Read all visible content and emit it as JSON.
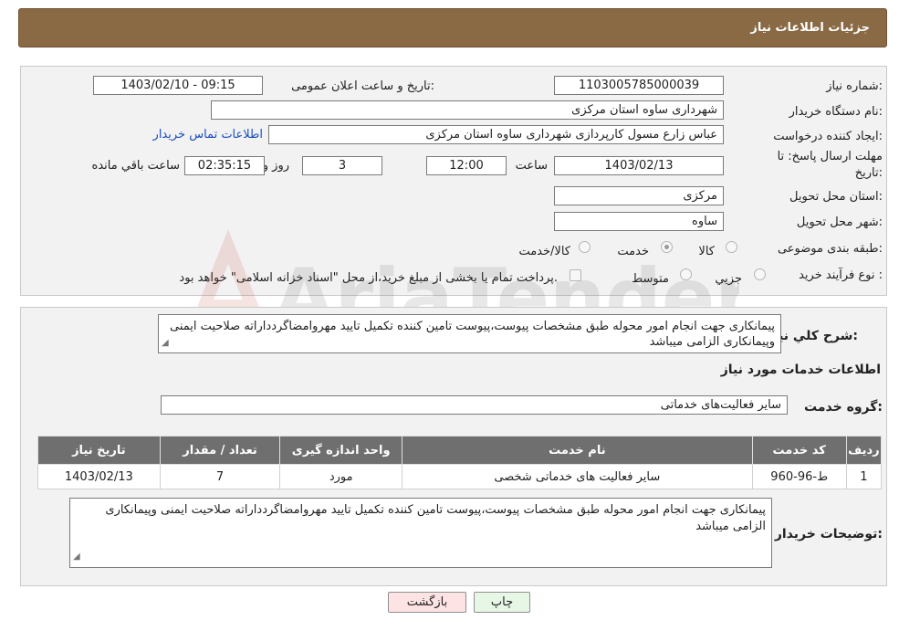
{
  "header": {
    "title": "جزئیات اطلاعات نیاز"
  },
  "need": {
    "number_label": "شماره نیاز:",
    "number_value": "1103005785000039",
    "announce_label": "تاریخ و ساعت اعلان عمومی:",
    "announce_value": "1403/02/10 - 09:15",
    "buyer_label": "نام دستگاه خریدار:",
    "buyer_value": "شهرداری ساوه استان مرکزی",
    "creator_label": "ایجاد کننده درخواست:",
    "creator_value": "عباس زارع مسول کارپردازی شهرداری ساوه استان مرکزی",
    "contact_link": "اطلاعات تماس خریدار",
    "deadline_label_1": "مهلت ارسال پاسخ: تا",
    "deadline_label_2": "تاریخ:",
    "deadline_date": "1403/02/13",
    "time_label": "ساعت",
    "deadline_time": "12:00",
    "days_value": "3",
    "days_label": "روز و",
    "remaining_value": "02:35:15",
    "remaining_label": "ساعت باقي مانده",
    "province_label": "استان محل تحویل:",
    "province_value": "مرکزی",
    "city_label": "شهر محل تحویل:",
    "city_value": "ساوه",
    "category_label": "طبقه بندی موضوعی:",
    "category_options": [
      "کالا",
      "خدمت",
      "کالا/خدمت"
    ],
    "category_selected": "خدمت",
    "process_label": "نوع فرآیند خرید :",
    "process_options": [
      "جزیي",
      "متوسط"
    ],
    "payment_note": "پرداخت تمام یا بخشی از مبلغ خرید،از محل \"اسناد خزانه اسلامی\" خواهد بود."
  },
  "description": {
    "label": "شرح کلي نياز:",
    "text": "پیمانکاری جهت انجام امور محوله طبق مشخصات پیوست،پیوست تامین کننده تکمیل تایید مهروامضاگردداراته صلاحیت ایمنی وپیمانکاری الزامی میباشد"
  },
  "services": {
    "section_title": "اطلاعات خدمات مورد نياز",
    "group_label": "گروه خدمت:",
    "group_value": "سایر فعالیت‌های خدماتی",
    "columns": [
      "رديف",
      "کد خدمت",
      "نام خدمت",
      "واحد اندازه گیری",
      "تعداد / مقدار",
      "تاريخ نياز"
    ],
    "rows": [
      [
        "1",
        "ط-96-960",
        "سایر فعالیت های خدماتی شخصی",
        "مورد",
        "7",
        "1403/02/13"
      ]
    ]
  },
  "buyer_notes": {
    "label": "توضيحات خريدار:",
    "text": "پیمانکاری جهت انجام امور محوله طبق مشخصات پیوست،پیوست تامین کننده تکمیل تایید مهروامضاگردداراته صلاحیت ایمنی وپیمانکاری الزامی میباشد"
  },
  "buttons": {
    "print": "چاپ",
    "back": "بازگشت"
  },
  "colors": {
    "title_bar": "#8a6a45",
    "table_header": "#6f6f6f",
    "link": "#1a4fc0",
    "back_button": "#fde3e3",
    "print_button": "#e6f7e6"
  },
  "watermark_text": "AriaTender.neT"
}
